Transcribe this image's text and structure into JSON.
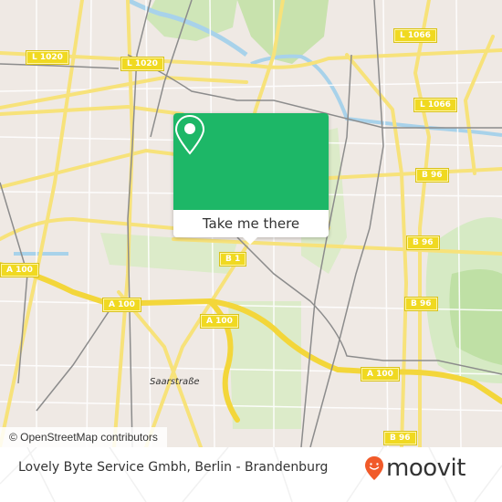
{
  "map": {
    "road_labels": [
      {
        "text": "L 1020",
        "name": "road-shield-l1020-west"
      },
      {
        "text": "L 1020",
        "name": "road-shield-l1020-center"
      },
      {
        "text": "L 1066",
        "name": "road-shield-l1066-north"
      },
      {
        "text": "L 1066",
        "name": "road-shield-l1066-east"
      },
      {
        "text": "B 96",
        "name": "road-shield-b96-north"
      },
      {
        "text": "B 96",
        "name": "road-shield-b96-middle"
      },
      {
        "text": "B 96",
        "name": "road-shield-b96-east"
      },
      {
        "text": "B 96",
        "name": "road-shield-b96-south"
      },
      {
        "text": "B 1",
        "name": "road-shield-b1"
      },
      {
        "text": "A 100",
        "name": "road-shield-a100-west"
      },
      {
        "text": "A 100",
        "name": "road-shield-a100-center"
      },
      {
        "text": "A 100",
        "name": "road-shield-a100-junction"
      },
      {
        "text": "A 100",
        "name": "road-shield-a100-east"
      }
    ],
    "place_labels": [
      {
        "text": "Saarstraße"
      }
    ],
    "attribution": "© OpenStreetMap contributors"
  },
  "popup": {
    "icon": "map-pin-icon",
    "cta_label": "Take me there",
    "color": "#1db767"
  },
  "footer": {
    "title": "Lovely Byte Service Gmbh, Berlin - Brandenburg",
    "logo_text": "moovit",
    "logo_icon": "moovit-pin-icon",
    "logo_color": "#f15a29"
  }
}
